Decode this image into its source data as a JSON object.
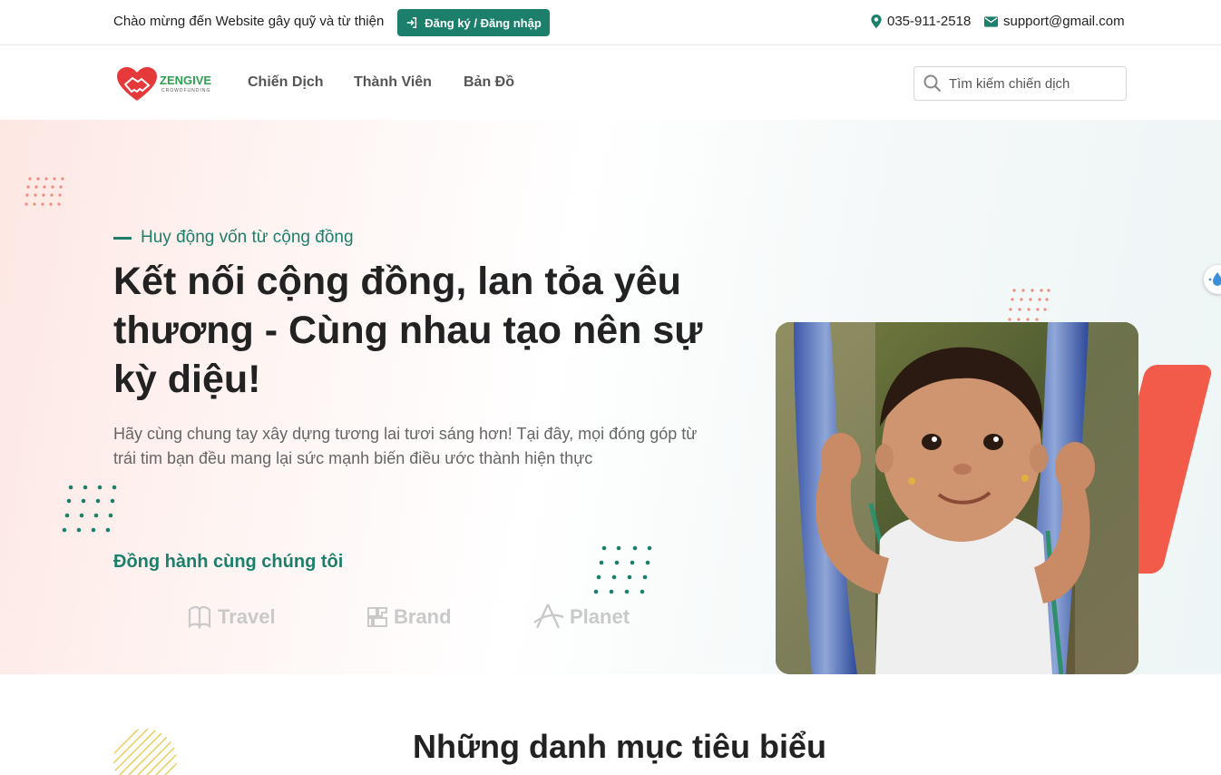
{
  "topbar": {
    "welcome": "Chào mừng đến Website gây quỹ và từ thiện",
    "auth_label": "Đăng ký / Đăng nhập",
    "phone": "035-911-2518",
    "email": "support@gmail.com"
  },
  "navbar": {
    "logo_text": "ZENGIVE",
    "logo_sub": "CROWDFUNDING",
    "links": [
      "Chiến Dịch",
      "Thành Viên",
      "Bản Đồ"
    ],
    "search_placeholder": "Tìm kiếm chiến dịch"
  },
  "hero": {
    "tagline": "Huy động vốn từ cộng đồng",
    "title": "Kết nối cộng đồng, lan tỏa yêu thương - Cùng nhau tạo nên sự kỳ diệu!",
    "description": "Hãy cùng chung tay xây dựng tương lai tươi sáng hơn! Tại đây, mọi đóng góp từ trái tim bạn đều mang lại sức mạnh biến điều ước thành hiện thực",
    "partners_title": "Đồng hành cùng chúng tôi",
    "partners": [
      "Travel",
      "Brand",
      "Planet"
    ]
  },
  "section": {
    "title": "Những danh mục tiêu biểu"
  },
  "colors": {
    "primary": "#1b7f6b",
    "accent_red": "#f25a4a",
    "dots_green": "#1b7f6b",
    "dots_red": "#f08a7e"
  }
}
